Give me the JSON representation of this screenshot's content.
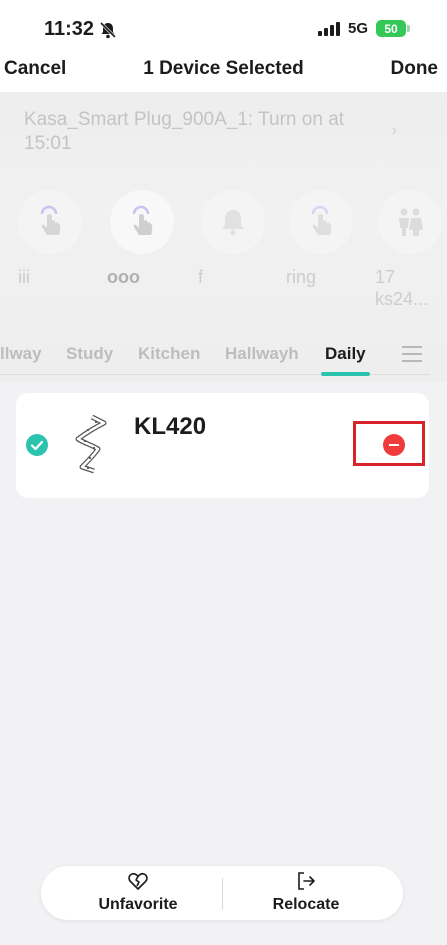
{
  "status_bar": {
    "time": "11:32",
    "network": "5G",
    "battery": "50"
  },
  "nav": {
    "cancel": "Cancel",
    "title": "1 Device Selected",
    "done": "Done"
  },
  "routine": {
    "text": "Kasa_Smart Plug_900A_1: Turn on at 15:01"
  },
  "shortcuts": [
    {
      "label": "iii",
      "icon": "tap-hand-icon"
    },
    {
      "label": "ooo",
      "icon": "tap-hand-icon"
    },
    {
      "label": "f",
      "icon": "bell-icon"
    },
    {
      "label": "ring",
      "icon": "tap-hand-icon"
    },
    {
      "label": "17 ks24...",
      "icon": "family-icon"
    }
  ],
  "tabs": [
    "llway",
    "Study",
    "Kitchen",
    "Hallwayh",
    "Daily"
  ],
  "active_tab": "Daily",
  "device": {
    "name": "KL420",
    "selected": true,
    "icon": "light-strip-icon"
  },
  "actions": {
    "unfavorite": "Unfavorite",
    "relocate": "Relocate"
  },
  "colors": {
    "accent": "#2cc3ae",
    "remove": "#ef3b3b",
    "highlight_frame": "#d8232a",
    "battery": "#36c759"
  }
}
